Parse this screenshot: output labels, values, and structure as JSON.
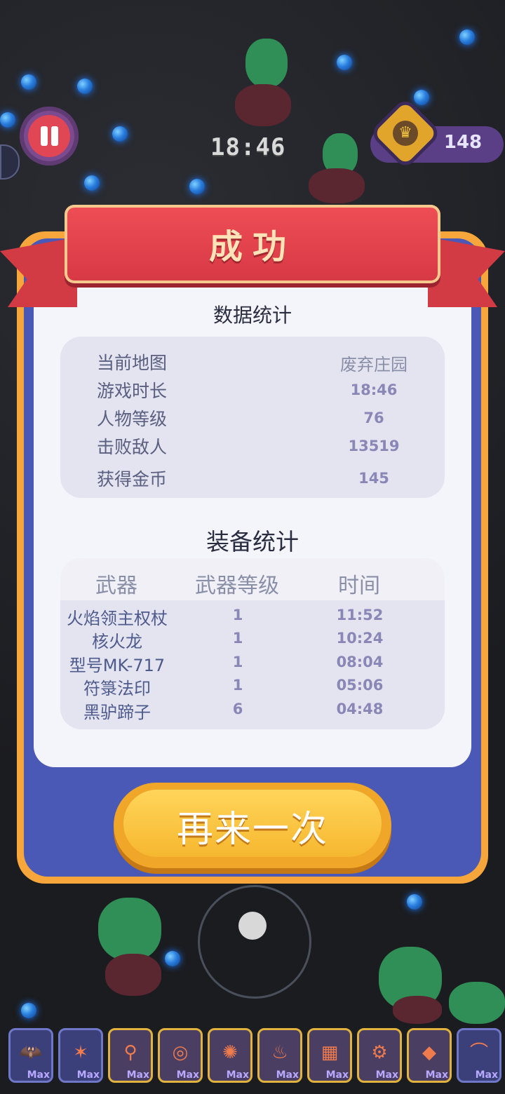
{
  "hud": {
    "timer": "18:46",
    "coins": "148"
  },
  "result": {
    "title": "成功",
    "stats_title": "数据统计",
    "stats": [
      {
        "label": "当前地图",
        "value": "废弃庄园"
      },
      {
        "label": "游戏时长",
        "value": "18:46"
      },
      {
        "label": "人物等级",
        "value": "76"
      },
      {
        "label": "击败敌人",
        "value": "13519"
      },
      {
        "label": "获得金币",
        "value": "145"
      }
    ],
    "equip_title": "装备统计",
    "equip_headers": [
      "武器",
      "武器等级",
      "时间"
    ],
    "equip_rows": [
      {
        "weapon": "火焰领主权杖",
        "level": "1",
        "time": "11:52"
      },
      {
        "weapon": "核火龙",
        "level": "1",
        "time": "10:24"
      },
      {
        "weapon": "型号MK-717",
        "level": "1",
        "time": "08:04"
      },
      {
        "weapon": "符箓法印",
        "level": "1",
        "time": "05:06"
      },
      {
        "weapon": "黑驴蹄子",
        "level": "6",
        "time": "04:48"
      }
    ],
    "retry_label": "再来一次"
  },
  "skill_bar": {
    "slots": [
      {
        "icon": "bat-icon",
        "glyph": "🦇",
        "label": "Max"
      },
      {
        "icon": "wings-icon",
        "glyph": "✶",
        "label": "Max"
      },
      {
        "icon": "wand-icon",
        "glyph": "⚲",
        "label": "Max"
      },
      {
        "icon": "target-icon",
        "glyph": "◎",
        "label": "Max"
      },
      {
        "icon": "orb-icon",
        "glyph": "✺",
        "label": "Max"
      },
      {
        "icon": "torch-icon",
        "glyph": "♨",
        "label": "Max"
      },
      {
        "icon": "cake-icon",
        "glyph": "▦",
        "label": "Max"
      },
      {
        "icon": "gear-icon",
        "glyph": "⚙",
        "label": "Max"
      },
      {
        "icon": "shell-icon",
        "glyph": "◆",
        "label": "Max"
      },
      {
        "icon": "claw-icon",
        "glyph": "⌒",
        "label": "Max"
      }
    ]
  },
  "colors": {
    "ribbon_red": "#d63844",
    "panel_blue": "#4a58b6",
    "button_gold": "#f6b72f",
    "value_purple": "#8a86b6"
  }
}
